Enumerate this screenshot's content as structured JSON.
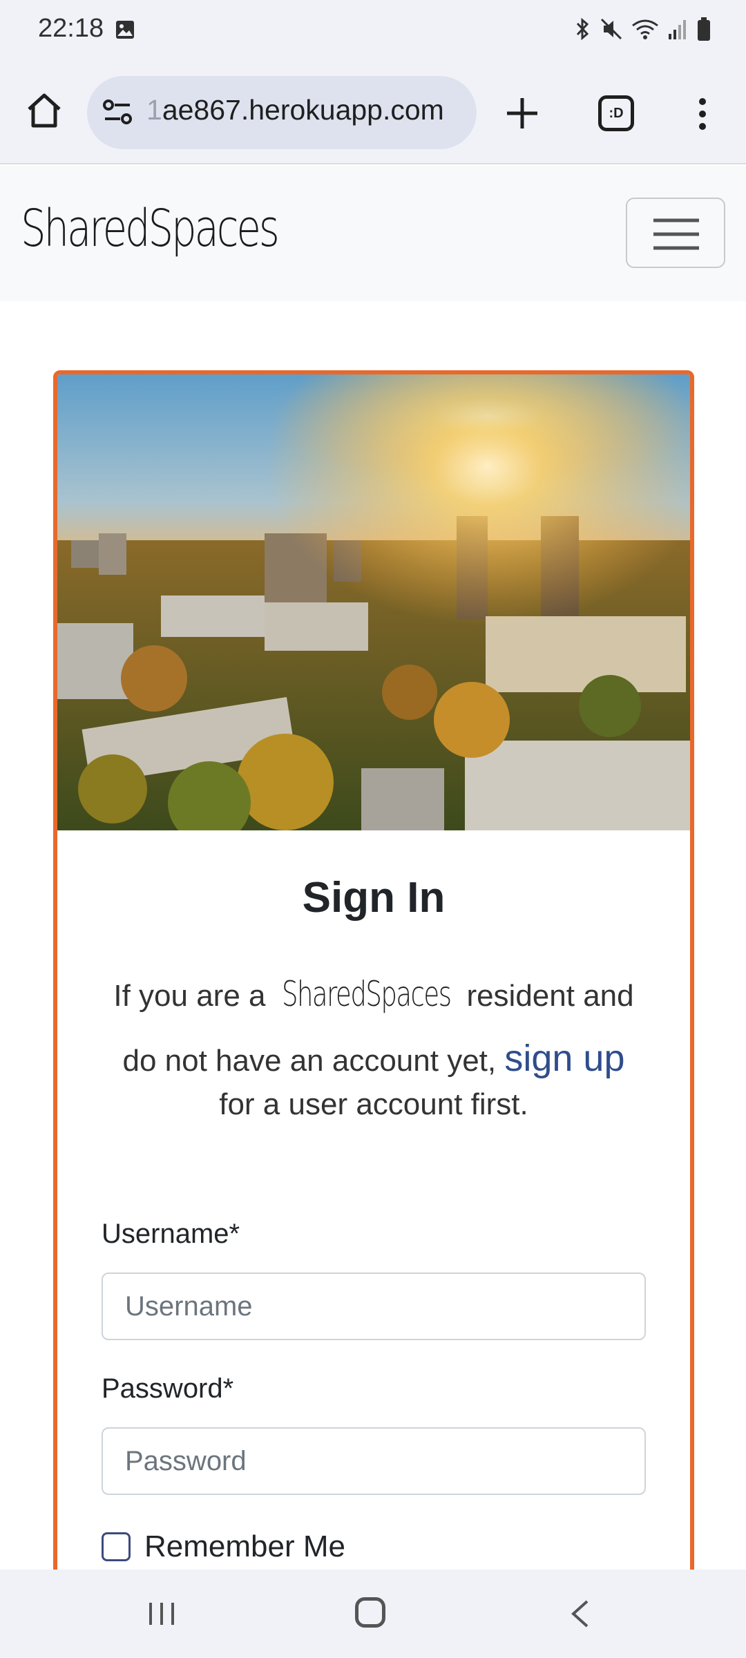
{
  "status_bar": {
    "time": "22:18",
    "left_icon": "gallery-notification-icon",
    "right_icons": [
      "bluetooth-icon",
      "mute-icon",
      "wifi-icon",
      "signal-icon",
      "battery-icon"
    ]
  },
  "browser": {
    "url_faded_prefix": "1",
    "url": "ae867.herokuapp.com",
    "tabs_label": ":D",
    "icons": [
      "home-icon",
      "site-settings-icon",
      "new-tab-icon",
      "tab-switcher-icon",
      "more-menu-icon"
    ]
  },
  "navbar": {
    "brand": "SharedSpaces",
    "toggler_icon": "hamburger-icon"
  },
  "card": {
    "title": "Sign In",
    "text_part1": "If you are a",
    "text_brand": "SharedSpaces",
    "text_part2": "resident and do not have an account yet,",
    "signup_link": "sign up",
    "text_part3": "for a user account first.",
    "image_alt": "city-sunrise-image"
  },
  "form": {
    "username_label": "Username*",
    "username_placeholder": "Username",
    "username_value": "",
    "password_label": "Password*",
    "password_placeholder": "Password",
    "password_value": "",
    "remember_label": "Remember Me"
  },
  "colors": {
    "card_border": "#e8692b",
    "link": "#2f4d8c",
    "browser_bg": "#f1f2f8",
    "navbar_bg": "#f8f9fa"
  }
}
